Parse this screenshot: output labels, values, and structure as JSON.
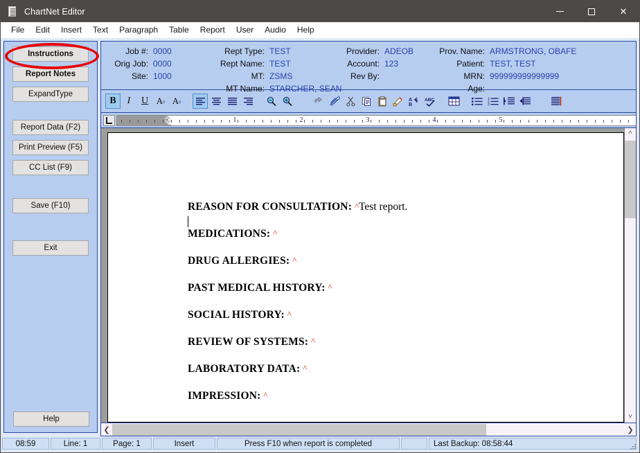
{
  "window": {
    "title": "ChartNet Editor",
    "icon": "document-icon",
    "controls": {
      "minimize": "minimize-icon",
      "maximize": "maximize-icon",
      "close": "close-icon"
    }
  },
  "menubar": {
    "items": [
      "File",
      "Edit",
      "Insert",
      "Text",
      "Paragraph",
      "Table",
      "Report",
      "User",
      "Audio",
      "Help"
    ]
  },
  "sidebar": {
    "buttons": [
      {
        "label": "Instructions",
        "bold": true
      },
      {
        "label": "Report Notes",
        "bold": true
      },
      {
        "label": "ExpandType",
        "bold": false
      },
      {
        "label": "Report Data (F2)",
        "bold": false
      },
      {
        "label": "Print Preview (F5)",
        "bold": false
      },
      {
        "label": "CC List (F9)",
        "bold": false
      },
      {
        "label": "Save (F10)",
        "bold": false
      },
      {
        "label": "Exit",
        "bold": false
      }
    ],
    "help_label": "Help"
  },
  "annotation": {
    "target": "Instructions",
    "color": "#e60000",
    "shape": "ellipse"
  },
  "info": {
    "col1": [
      {
        "label": "Job #:",
        "value": "0000"
      },
      {
        "label": "Orig Job:",
        "value": "0000"
      },
      {
        "label": "Site:",
        "value": "1000"
      }
    ],
    "col2": [
      {
        "label": "Rept Type:",
        "value": "TEST"
      },
      {
        "label": "Rept Name:",
        "value": "TEST"
      },
      {
        "label": "MT:",
        "value": "ZSMS"
      },
      {
        "label": "MT Name:",
        "value": "STARCHER, SEAN"
      }
    ],
    "col3": [
      {
        "label": "Provider:",
        "value": "ADEOB"
      },
      {
        "label": "Account:",
        "value": "123"
      },
      {
        "label": "Rev By:",
        "value": ""
      }
    ],
    "col4": [
      {
        "label": "Prov. Name:",
        "value": "ARMSTRONG, OBAFE"
      },
      {
        "label": "Patient:",
        "value": "TEST, TEST"
      },
      {
        "label": "MRN:",
        "value": "999999999999999"
      },
      {
        "label": "Age:",
        "value": ""
      }
    ]
  },
  "toolbar": {
    "buttons": [
      {
        "name": "bold-icon",
        "glyph": "B",
        "selected": true
      },
      {
        "name": "italic-icon",
        "glyph": "I",
        "selected": false
      },
      {
        "name": "underline-icon",
        "glyph": "U",
        "selected": false
      },
      {
        "name": "superscript-icon",
        "glyph": "A",
        "selected": false
      },
      {
        "name": "subscript-icon",
        "glyph": "A",
        "selected": false
      },
      {
        "name": "align-left-icon",
        "glyph": "",
        "selected": true
      },
      {
        "name": "align-center-icon",
        "glyph": "",
        "selected": false
      },
      {
        "name": "align-justify-icon",
        "glyph": "",
        "selected": false
      },
      {
        "name": "align-right-icon",
        "glyph": "",
        "selected": false
      },
      {
        "name": "zoom-out-icon",
        "glyph": "",
        "selected": false
      },
      {
        "name": "zoom-in-icon",
        "glyph": "",
        "selected": false
      },
      {
        "name": "undo-icon",
        "glyph": "",
        "selected": false
      },
      {
        "name": "highlight-icon",
        "glyph": "",
        "selected": false
      },
      {
        "name": "cut-icon",
        "glyph": "",
        "selected": false
      },
      {
        "name": "copy-icon",
        "glyph": "",
        "selected": false
      },
      {
        "name": "paste-icon",
        "glyph": "",
        "selected": false
      },
      {
        "name": "format-painter-icon",
        "glyph": "",
        "selected": false
      },
      {
        "name": "find-replace-icon",
        "glyph": "",
        "selected": false
      },
      {
        "name": "spell-check-icon",
        "glyph": "",
        "selected": false
      },
      {
        "name": "insert-table-icon",
        "glyph": "",
        "selected": false
      },
      {
        "name": "bullet-list-icon",
        "glyph": "",
        "selected": false
      },
      {
        "name": "numbered-list-icon",
        "glyph": "",
        "selected": false
      },
      {
        "name": "increase-indent-icon",
        "glyph": "",
        "selected": false
      },
      {
        "name": "decrease-indent-icon",
        "glyph": "",
        "selected": false
      },
      {
        "name": "page-break-icon",
        "glyph": "",
        "selected": false
      }
    ]
  },
  "ruler": {
    "numbers": [
      "1",
      "2",
      "3",
      "4",
      "5"
    ],
    "unit": "inches"
  },
  "document": {
    "lines": [
      {
        "heading": "REASON FOR CONSULTATION:",
        "caret": "^",
        "text": "Test report."
      },
      {
        "heading": "MEDICATIONS:",
        "caret": "^",
        "text": ""
      },
      {
        "heading": "DRUG ALLERGIES:",
        "caret": "^",
        "text": ""
      },
      {
        "heading": "PAST MEDICAL HISTORY:",
        "caret": "^",
        "text": ""
      },
      {
        "heading": "SOCIAL HISTORY:",
        "caret": "^",
        "text": ""
      },
      {
        "heading": "REVIEW OF SYSTEMS:",
        "caret": "^",
        "text": ""
      },
      {
        "heading": "LABORATORY DATA:",
        "caret": "^",
        "text": ""
      },
      {
        "heading": "IMPRESSION:",
        "caret": "^",
        "text": ""
      }
    ]
  },
  "statusbar": {
    "time": "08:59",
    "line": "Line:  1",
    "page": "Page:  1",
    "mode": "Insert",
    "hint": "Press F10 when report is completed",
    "backup": "Last Backup: 08:58:44"
  }
}
